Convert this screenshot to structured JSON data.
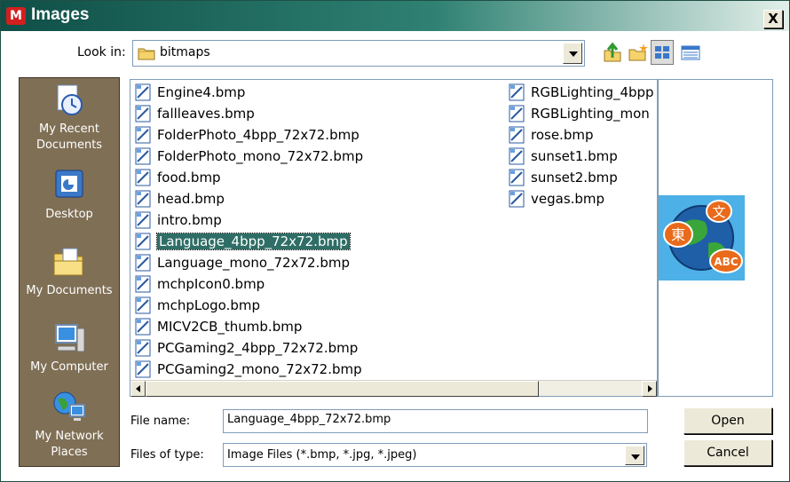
{
  "window": {
    "title": "Images",
    "app_icon": "microchip-logo-icon",
    "close_label": "X"
  },
  "look_in": {
    "label": "Look in:",
    "value": "bitmaps"
  },
  "toolbar": {
    "icons": [
      "up-folder-icon",
      "new-folder-icon",
      "list-view-icon",
      "details-view-icon"
    ]
  },
  "places": [
    {
      "label": "My Recent Documents",
      "icon": "recent-documents-icon"
    },
    {
      "label": "Desktop",
      "icon": "desktop-icon"
    },
    {
      "label": "My Documents",
      "icon": "my-documents-icon"
    },
    {
      "label": "My Computer",
      "icon": "my-computer-icon"
    },
    {
      "label": "My Network Places",
      "icon": "network-places-icon"
    }
  ],
  "files": {
    "column1": [
      "Engine4.bmp",
      "fallleaves.bmp",
      "FolderPhoto_4bpp_72x72.bmp",
      "FolderPhoto_mono_72x72.bmp",
      "food.bmp",
      "head.bmp",
      "intro.bmp",
      "Language_4bpp_72x72.bmp",
      "Language_mono_72x72.bmp",
      "mchpIcon0.bmp",
      "mchpLogo.bmp",
      "MICV2CB_thumb.bmp",
      "PCGaming2_4bpp_72x72.bmp",
      "PCGaming2_mono_72x72.bmp"
    ],
    "column2": [
      "RGBLighting_4bpp",
      "RGBLighting_mon",
      "rose.bmp",
      "sunset1.bmp",
      "sunset2.bmp",
      "vegas.bmp"
    ],
    "selected": "Language_4bpp_72x72.bmp",
    "file_icon": "bitmap-file-icon"
  },
  "preview": {
    "text_kanji_top": "文",
    "text_kanji_left": "東",
    "text_abc": "ABC"
  },
  "file_name": {
    "label": "File name:",
    "value": "Language_4bpp_72x72.bmp"
  },
  "file_type": {
    "label": "Files of type:",
    "value": "Image Files (*.bmp, *.jpg, *.jpeg)"
  },
  "buttons": {
    "open": "Open",
    "cancel": "Cancel"
  },
  "colors": {
    "titlebar": "#0f4f47",
    "places_bg": "#7f6f55",
    "selection": "#2e6e66"
  }
}
